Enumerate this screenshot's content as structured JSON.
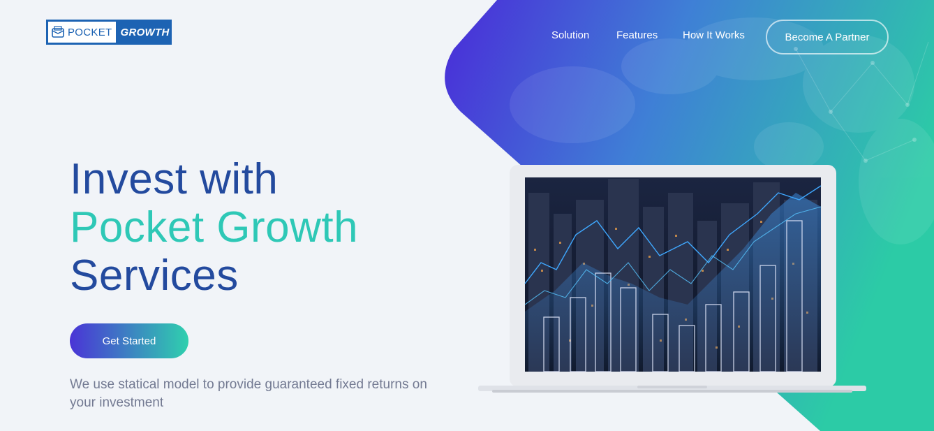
{
  "brand": {
    "logo_word_1": "POCKET",
    "logo_word_2": "GROWTH",
    "logo_icon": "wallet-icon",
    "brand_blue": "#1d63b3"
  },
  "nav": {
    "items": [
      {
        "label": "Solution"
      },
      {
        "label": "Features"
      },
      {
        "label": "How It Works"
      }
    ],
    "partner_label": "Become A Partner"
  },
  "hero": {
    "line1": "Invest with",
    "line2": "Pocket Growth",
    "line3": "Services",
    "cta_label": "Get Started",
    "description": "We use statical model to provide guaranteed fixed returns on your investment"
  },
  "colors": {
    "title_blue": "#234a9e",
    "title_teal": "#2ec8b6",
    "gradient_start": "#4a34d6",
    "gradient_end": "#2fd0ae",
    "description_gray": "#737a92"
  },
  "illustration": {
    "subject": "laptop-city-chart"
  }
}
